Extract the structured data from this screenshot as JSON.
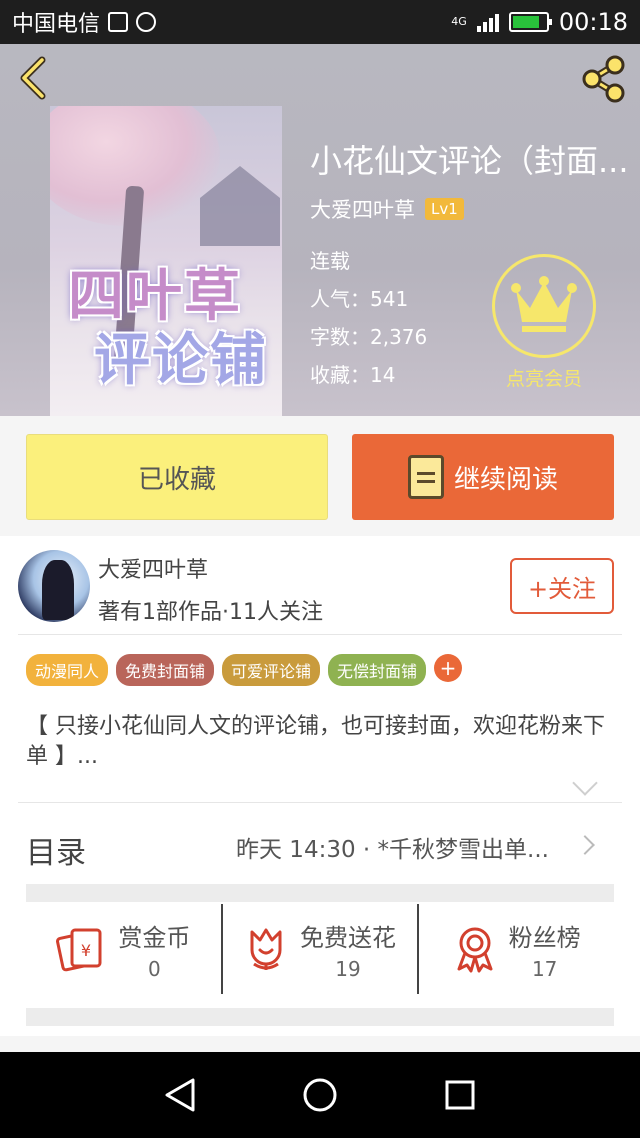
{
  "status_bar": {
    "carrier": "中国电信",
    "network": "4G",
    "time": "00:18"
  },
  "book": {
    "title": "小花仙文评论（封面...",
    "cover_art_text": "四叶草评论铺",
    "author": "大爱四叶草",
    "level": "Lv1",
    "status": "连载",
    "popularity_label": "人气：",
    "popularity": "541",
    "words_label": "字数：",
    "words": "2,376",
    "favorites_label": "收藏：",
    "favorites": "14",
    "vip_label": "点亮会员"
  },
  "actions": {
    "favorited_label": "已收藏",
    "continue_label": "继续阅读"
  },
  "author_panel": {
    "name": "大爱四叶草",
    "stats": "著有1部作品·11人关注",
    "follow_label": "+关注"
  },
  "tags": [
    {
      "label": "动漫同人",
      "color": "#f2b23c"
    },
    {
      "label": "免费封面铺",
      "color": "#b9655a"
    },
    {
      "label": "可爱评论铺",
      "color": "#c99b3c"
    },
    {
      "label": "无偿封面铺",
      "color": "#8fb251"
    }
  ],
  "tag_add": "+",
  "description": "【 只接小花仙同人文的评论铺，也可接封面，欢迎花粉来下单 】...",
  "toc": {
    "label": "目录",
    "latest": "昨天 14:30 · *千秋梦雪出单..."
  },
  "stats": [
    {
      "label": "赏金币",
      "value": "0",
      "icon": "red-envelope-icon"
    },
    {
      "label": "免费送花",
      "value": "19",
      "icon": "flower-icon"
    },
    {
      "label": "粉丝榜",
      "value": "17",
      "icon": "medal-icon"
    }
  ],
  "colors": {
    "accent": "#ea6838",
    "fav_button": "#fbf07c",
    "vip": "#f6e76b",
    "icon_red": "#d2402e"
  }
}
